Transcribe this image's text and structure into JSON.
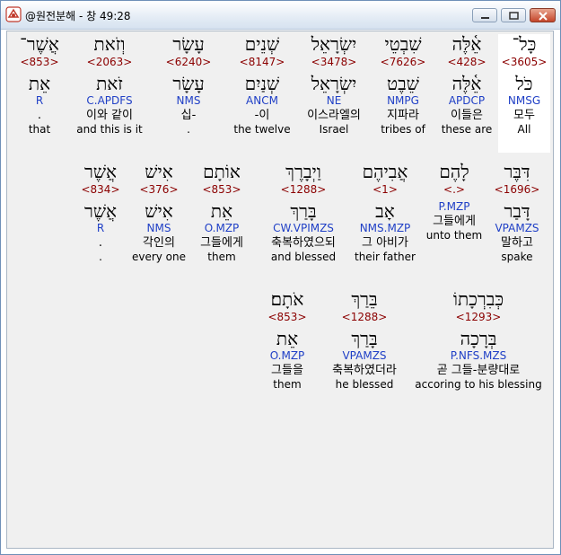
{
  "window": {
    "title": "@원전분해 - 창 49:28",
    "buttons": [
      "minimize",
      "maximize",
      "close"
    ]
  },
  "rows": [
    [
      {
        "heb": "כָּל־",
        "strong": "<3605>",
        "lemma": "כֹּל",
        "morph": "NMSG",
        "kor": "모두",
        "eng": "All",
        "selected": true
      },
      {
        "heb": "אֵ֫לֶּה",
        "strong": "<428>",
        "lemma": "אֵ֫לֶּה",
        "morph": "APDCP",
        "kor": "이들은",
        "eng": "these are"
      },
      {
        "heb": "שִׁבְטֵי",
        "strong": "<7626>",
        "lemma": "שֵׁבֶט",
        "morph": "NMPG",
        "kor": "지파라",
        "eng": "tribes of"
      },
      {
        "heb": "יִשְׂרָאֵל",
        "strong": "<3478>",
        "lemma": "יִשְׂרָאֵל",
        "morph": "NE",
        "kor": "이스라엘의",
        "eng": "Israel"
      },
      {
        "heb": "שְׁנֵים",
        "strong": "<8147>",
        "lemma": "שְׁנַיִם",
        "morph": "ANCM",
        "kor": "-이",
        "eng": "the twelve"
      },
      {
        "heb": "עָשָׂר",
        "strong": "<6240>",
        "lemma": "עָשָׂר",
        "morph": "NMS",
        "kor": "십-",
        "eng": "."
      },
      {
        "heb": "וְזֹאת",
        "strong": "<2063>",
        "lemma": "זֹאת",
        "morph": "C.APDFS",
        "kor": "이와 같이",
        "eng": "and this is it"
      },
      {
        "heb": "אֲשֶׁר־",
        "strong": "<853>",
        "lemma": "אֵת",
        "morph": "R",
        "kor": ".",
        "eng": "that"
      }
    ],
    [
      {
        "heb": "דִּבֶּר",
        "strong": "<1696>",
        "lemma": "דָּבַר",
        "morph": "VPAMZS",
        "kor": "말하고",
        "eng": "spake"
      },
      {
        "heb": "לָהֶם",
        "strong": "<.>",
        "lemma": "",
        "morph": "P.MZP",
        "kor": "그들에게",
        "eng": "unto them"
      },
      {
        "heb": "אֲבִיהֶם",
        "strong": "<1>",
        "lemma": "אָב",
        "morph": "NMS.MZP",
        "kor": "그 아비가",
        "eng": "their father"
      },
      {
        "heb": "וַיְבָרֶךְ",
        "strong": "<1288>",
        "lemma": "בָּרַךְ",
        "morph": "CW.VPIMZS",
        "kor": "축복하였으되",
        "eng": "and blessed"
      },
      {
        "heb": "אוֹתָם",
        "strong": "<853>",
        "lemma": "אֵת",
        "morph": "O.MZP",
        "kor": "그들에게",
        "eng": "them"
      },
      {
        "heb": "אִישׁ",
        "strong": "<376>",
        "lemma": "אִישׁ",
        "morph": "NMS",
        "kor": "각인의",
        "eng": "every one"
      },
      {
        "heb": "אֲשֶׁר",
        "strong": "<834>",
        "lemma": "אֲשֶׁר",
        "morph": "R",
        "kor": ".",
        "eng": "."
      }
    ],
    [
      {
        "heb": "כְּבִרְכָתוֹ",
        "strong": "<1293>",
        "lemma": "בְּרָכָה",
        "morph": "P.NFS.MZS",
        "kor": "곧 그들-분량대로",
        "eng": "accoring to his blessing"
      },
      {
        "heb": "בֵּרַךְ",
        "strong": "<1288>",
        "lemma": "בָּרַךְ",
        "morph": "VPAMZS",
        "kor": "축복하였더라",
        "eng": "he blessed"
      },
      {
        "heb": "אֹתָם׃",
        "strong": "<853>",
        "lemma": "אֵת",
        "morph": "O.MZP",
        "kor": "그들을",
        "eng": "them"
      }
    ]
  ]
}
